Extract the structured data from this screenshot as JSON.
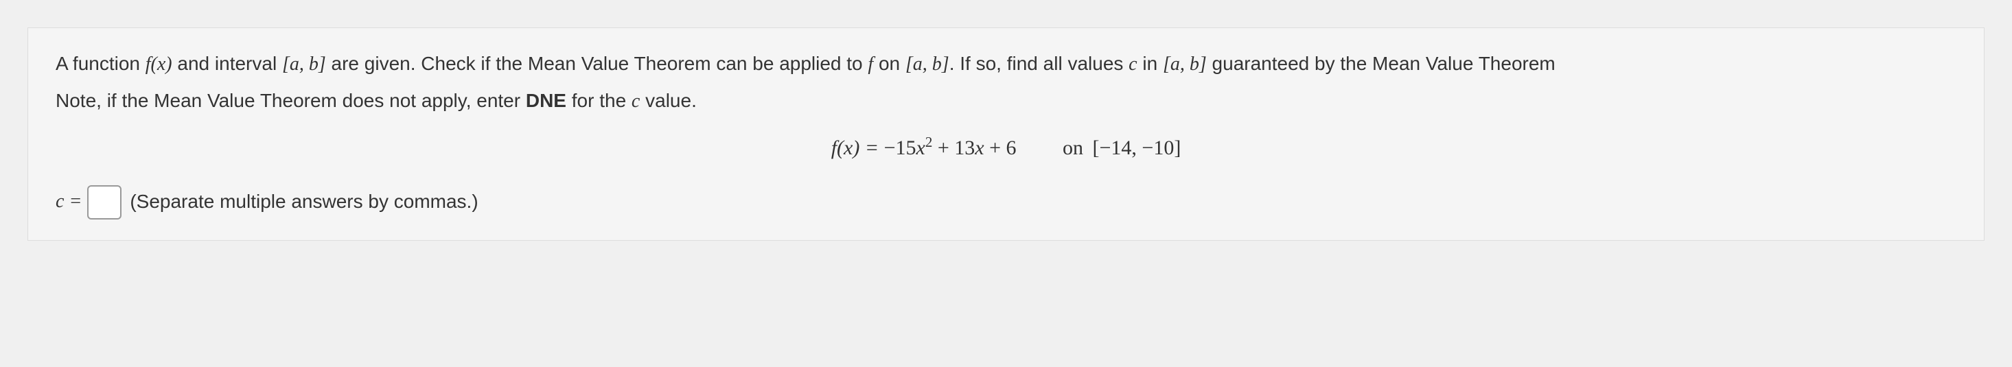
{
  "problem": {
    "line1_part1": "A function ",
    "line1_fx": "f(x)",
    "line1_part2": " and interval ",
    "line1_interval": "[a, b]",
    "line1_part3": " are given. Check if the Mean Value Theorem can be applied to ",
    "line1_f": "f",
    "line1_part4": " on ",
    "line1_interval2": "[a, b]",
    "line1_part5": ". If so, find all values ",
    "line1_c": "c",
    "line1_part6": " in ",
    "line1_interval3": "[a, b]",
    "line1_part7": " guaranteed by the Mean Value Theorem",
    "line2_part1": "Note, if the Mean Value Theorem does not apply, enter ",
    "line2_dne": "DNE",
    "line2_part2": " for the ",
    "line2_c": "c",
    "line2_part3": " value."
  },
  "equation": {
    "lhs": "f(x) = ",
    "rhs_coef1": "−15",
    "rhs_var1": "x",
    "rhs_exp": "2",
    "rhs_mid": " + 13",
    "rhs_var2": "x",
    "rhs_end": " + 6",
    "on_label": "on ",
    "interval": "[−14, −10]"
  },
  "answer": {
    "label_c": "c",
    "label_eq": " = ",
    "hint": "(Separate multiple answers by commas.)"
  }
}
